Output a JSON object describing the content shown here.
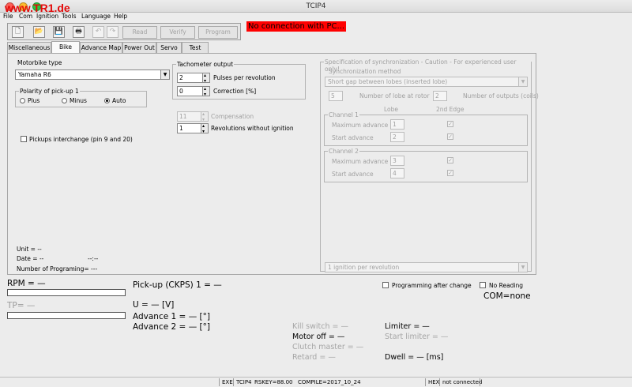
{
  "window": {
    "title": "TCIP4",
    "brand_text": "www.TR1.de"
  },
  "menu": [
    "File",
    "Com",
    "Ignition",
    "Tools",
    "Language",
    "Help"
  ],
  "toolbar": {
    "new_icon": "new-document-icon",
    "open_icon": "open-folder-icon",
    "save_icon": "save-disk-icon",
    "print_icon": "printer-icon",
    "undo_icon": "undo-icon",
    "redo_icon": "redo-icon",
    "read_label": "Read",
    "verify_label": "Verify",
    "program_label": "Program"
  },
  "connection_status": "No connection with PC...",
  "tabs": [
    "Miscellaneous",
    "Bike",
    "Advance Map",
    "Power Out",
    "Servo",
    "Test"
  ],
  "active_tab": "Bike",
  "bike": {
    "type_label": "Motorbike type",
    "type_value": "Yamaha R6",
    "polarity": {
      "label": "Polarity of pick-up 1",
      "options": [
        "Plus",
        "Minus",
        "Auto"
      ],
      "selected": "Auto"
    },
    "pickups_interchange_label": "Pickups interchange (pin 9 and 20)",
    "pickups_interchange_checked": false,
    "tachometer": {
      "label": "Tachometer output",
      "pulses_value": "2",
      "pulses_label": "Pulses per revolution",
      "correction_value": "0",
      "correction_label": "Correction [%]"
    },
    "compensation": {
      "value": "11",
      "label": "Compensation"
    },
    "revolutions": {
      "value": "1",
      "label": "Revolutions without ignition"
    },
    "unit_label": "Unit = --",
    "date_label": "Date = --",
    "time_label": "--:--",
    "programming_count_label": "Number of Programing= ---"
  },
  "sync": {
    "title": "Specification of synchronization - Caution - For experienced user only!",
    "method_label": "Synchronization method",
    "method_value": "Short gap between lobes (inserted lobe)",
    "lobe_at_rotor_value": "5",
    "lobe_at_rotor_label": "Number of lobe at rotor",
    "outputs_value": "2",
    "outputs_label": "Number of outputs (coils)",
    "col_lobe": "Lobe",
    "col_2nd_edge": "2nd Edge",
    "channel1": {
      "label": "Channel 1",
      "max_label": "Maximum advance",
      "max_value": "1",
      "start_label": "Start advance",
      "start_value": "2"
    },
    "channel2": {
      "label": "Channel 2",
      "max_label": "Maximum advance",
      "max_value": "3",
      "start_label": "Start advance",
      "start_value": "4"
    },
    "ignition_value": "1 ignition per revolution"
  },
  "live": {
    "rpm": "RPM = —",
    "tp": "TP= —",
    "pickup": "Pick-up (CKPS) 1 = —",
    "voltage": "U = — [V]",
    "advance1": "Advance 1 = — [°]",
    "advance2": "Advance 2 = — [°]",
    "kill_switch": "Kill switch = —",
    "motor_off": "Motor off = —",
    "clutch_master": "Clutch master = —",
    "retard": "Retard = —",
    "limiter": "Limiter = —",
    "start_limiter": "Start limiter = —",
    "dwell": "Dwell = — [ms]",
    "programming_after_change": "Programming after change",
    "no_reading": "No Reading",
    "com": "COM=none"
  },
  "statusbar": {
    "exe": "EXE",
    "name": "TCIP4",
    "rskey": "RSKEY=88.00",
    "compile": "COMPILE=2017_10_24",
    "hex": "HEX",
    "conn": "not connected"
  },
  "colors": {
    "status_red": "#ff0000",
    "brand_red": "#e30a0a",
    "traffic_red": "#fe5f57",
    "traffic_yellow": "#febc2e",
    "traffic_green": "#28c840"
  }
}
